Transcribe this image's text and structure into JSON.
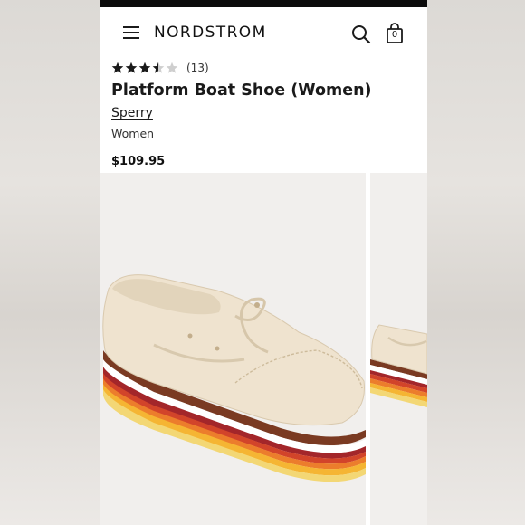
{
  "header": {
    "logo_text": "NORDSTROM",
    "menu_icon": "hamburger-menu-icon",
    "search_icon": "search-icon",
    "bag_icon": "shopping-bag-icon",
    "bag_count": "0"
  },
  "product": {
    "rating": 3.5,
    "rating_max": 5,
    "review_count": "(13)",
    "title": "Platform Boat Shoe (Women)",
    "brand": "Sperry",
    "department": "Women",
    "price": "$109.95"
  },
  "gallery": {
    "main_image": "cream-leather-platform-boat-shoe-with-rainbow-striped-sole",
    "next_image": "partial-view-of-same-shoe"
  },
  "colors": {
    "star_filled": "#1a1a1a",
    "star_empty": "#cfcfcf",
    "status_bar": "#0b0b0b"
  }
}
